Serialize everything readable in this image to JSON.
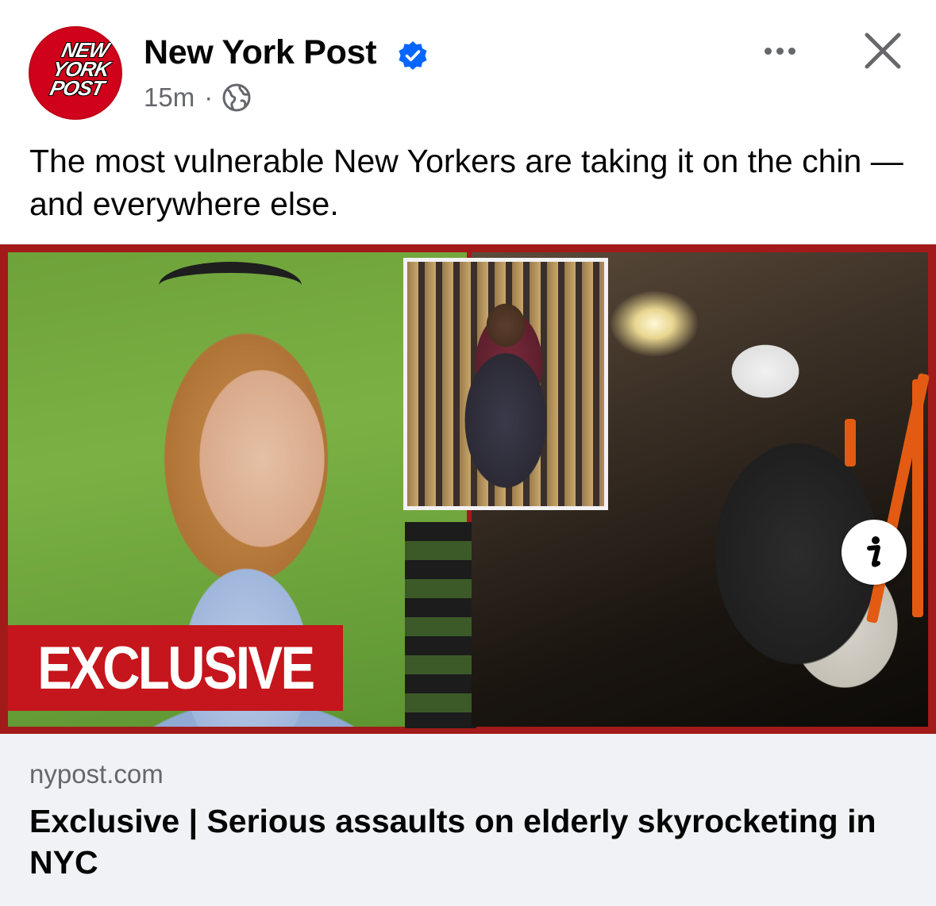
{
  "post": {
    "page_name": "New York Post",
    "avatar_lines": [
      "NEW",
      "YORK",
      "POST"
    ],
    "time": "15m",
    "separator": "·",
    "audience_icon": "globe-icon",
    "verified_icon": "verified-badge-icon",
    "caption": "The most vulnerable New Yorkers are taking it on the chin — and everywhere else."
  },
  "media": {
    "badge_text": "EXCLUSIVE",
    "info_label": "i"
  },
  "link": {
    "domain": "nypost.com",
    "title": "Exclusive | Serious assaults on elderly skyrocketing in NYC"
  },
  "colors": {
    "brand_red": "#d0021b",
    "verified_blue": "#0866ff",
    "secondary_text": "#65676b",
    "link_bg": "#f0f2f5"
  }
}
